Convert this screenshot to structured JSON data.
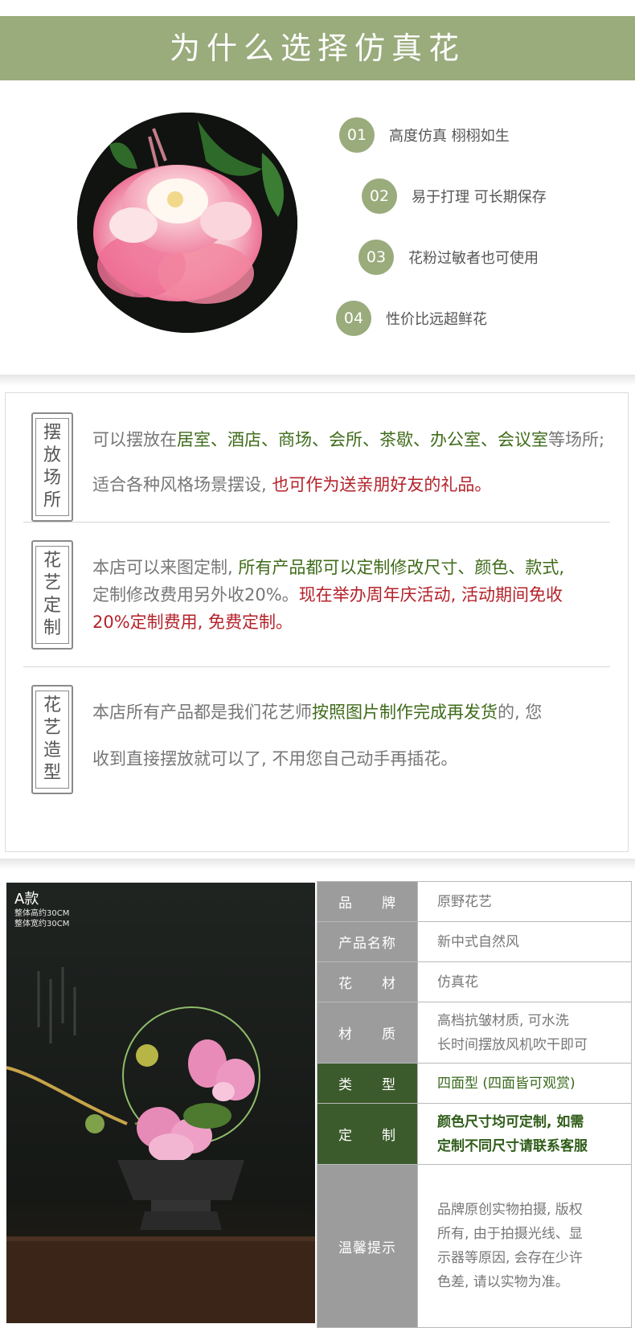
{
  "banner": {
    "title": "为什么选择仿真花"
  },
  "features": [
    {
      "num": "01",
      "text": "高度仿真 栩栩如生"
    },
    {
      "num": "02",
      "text": "易于打理 可长期保存"
    },
    {
      "num": "03",
      "text": "花粉过敏者也可使用"
    },
    {
      "num": "04",
      "text": "性价比远超鲜花"
    }
  ],
  "sections": [
    {
      "label": [
        "摆",
        "放",
        "场",
        "所"
      ],
      "line1": {
        "a": "可以摆放在",
        "b": "居室、酒店、商场、会所、茶歇、办公室、会议室",
        "c": "等场所;"
      },
      "line2": {
        "a": "适合各种风格场景摆设, ",
        "b": "也可作为送亲朋好友的礼品。"
      }
    },
    {
      "label": [
        "花",
        "艺",
        "定",
        "制"
      ],
      "line1": {
        "a": "本店可以来图定制, ",
        "b": "所有产品都可以定制修改尺寸、颜色、款式,"
      },
      "line2": {
        "a": "定制修改费用另外收20%。",
        "b": "现在举办周年庆活动, 活动期间免收"
      },
      "line3": {
        "b": "20%定制费用, 免费定制。"
      }
    },
    {
      "label": [
        "花",
        "艺",
        "造",
        "型"
      ],
      "line1": {
        "a": "本店所有产品都是我们花艺师",
        "b": "按照图片制作完成再发货",
        "c": "的, 您"
      },
      "line2": {
        "a": "收到直接摆放就可以了, 不用您自己动手再插花。"
      }
    }
  ],
  "product": {
    "tag_title": "A款",
    "tag_lines": [
      "整体高约30CM",
      "整体宽约30CM"
    ]
  },
  "specs": [
    {
      "key": "品　　牌",
      "lines": [
        "原野花艺"
      ],
      "style": "normal"
    },
    {
      "key": "产品名称",
      "lines": [
        "新中式自然风"
      ],
      "style": "normal"
    },
    {
      "key": "花　　材",
      "lines": [
        "仿真花"
      ],
      "style": "normal"
    },
    {
      "key": "材　　质",
      "lines": [
        "高档抗皱材质, 可水洗",
        "长时间摆放风机吹干即可"
      ],
      "style": "normal"
    },
    {
      "key": "类　　型",
      "lines": [
        "四面型 (四面皆可观赏)"
      ],
      "style": "green"
    },
    {
      "key": "定　　制",
      "lines": [
        "颜色尺寸均可定制, 如需",
        "定制不同尺寸请联系客服"
      ],
      "style": "bold"
    },
    {
      "key": "温馨提示",
      "lines": [
        "品牌原创实物拍摄, 版权",
        "所有, 由于拍摄光线、显",
        "示器等原因, 会存在少许",
        "色差, 请以实物为准。"
      ],
      "style": "normal"
    }
  ],
  "colors": {
    "banner": "#9aab7c",
    "accent_green": "#3f6b1a",
    "accent_red": "#b4222a",
    "spec_key_grey": "#9c9c9c",
    "spec_key_dark": "#3c5b2c"
  }
}
